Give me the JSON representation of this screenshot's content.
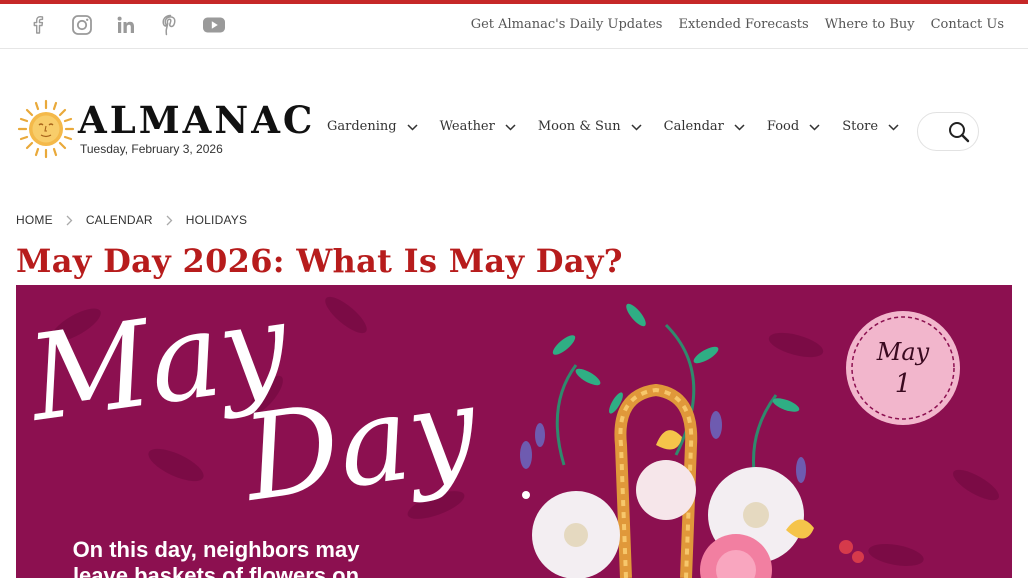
{
  "social": [
    {
      "name": "facebook-icon"
    },
    {
      "name": "instagram-icon"
    },
    {
      "name": "linkedin-icon"
    },
    {
      "name": "pinterest-icon"
    },
    {
      "name": "youtube-icon"
    }
  ],
  "toplinks": [
    "Get Almanac's Daily Updates",
    "Extended Forecasts",
    "Where to Buy",
    "Contact Us"
  ],
  "logo": {
    "wordmark": "ALMANAC",
    "date": "Tuesday, February 3, 2026"
  },
  "nav": [
    "Gardening",
    "Weather",
    "Moon & Sun",
    "Calendar",
    "Food",
    "Store"
  ],
  "breadcrumb": [
    "HOME",
    "CALENDAR",
    "HOLIDAYS"
  ],
  "page_title": "May Day 2026: What Is May Day?",
  "hero": {
    "script_line1": "May",
    "script_line2": "Day",
    "badge_month": "May",
    "badge_day": "1",
    "caption_line1": "On this day, neighbors may",
    "caption_line2": "leave baskets of flowers on"
  },
  "colors": {
    "accent_red": "#b71c1c",
    "hero_bg": "#8c1050",
    "badge_pink": "#f2b6cc"
  }
}
